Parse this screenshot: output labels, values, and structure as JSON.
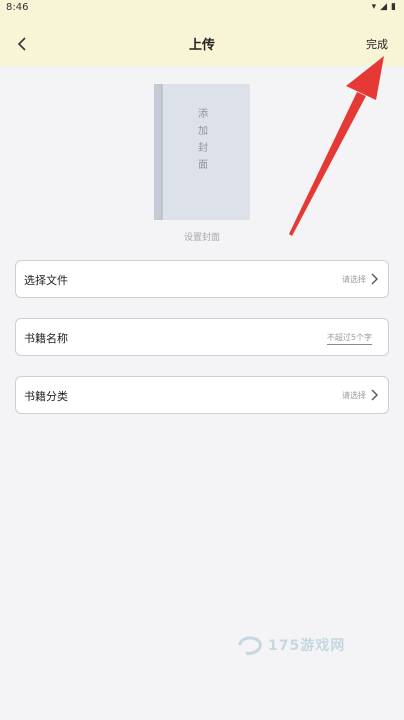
{
  "status": {
    "time": "8:46"
  },
  "header": {
    "title": "上传",
    "done_label": "完成"
  },
  "cover": {
    "placeholder_chars": [
      "添",
      "加",
      "封",
      "面"
    ],
    "caption": "设置封面"
  },
  "form": {
    "rows": [
      {
        "label": "选择文件",
        "value": "请选择"
      },
      {
        "label": "书籍名称",
        "value": "不超过5个字"
      },
      {
        "label": "书籍分类",
        "value": "请选择"
      }
    ]
  },
  "watermark": {
    "text": "175游戏网"
  },
  "colors": {
    "header_bg": "#f8f4d6",
    "annotation_arrow": "#e53935"
  }
}
